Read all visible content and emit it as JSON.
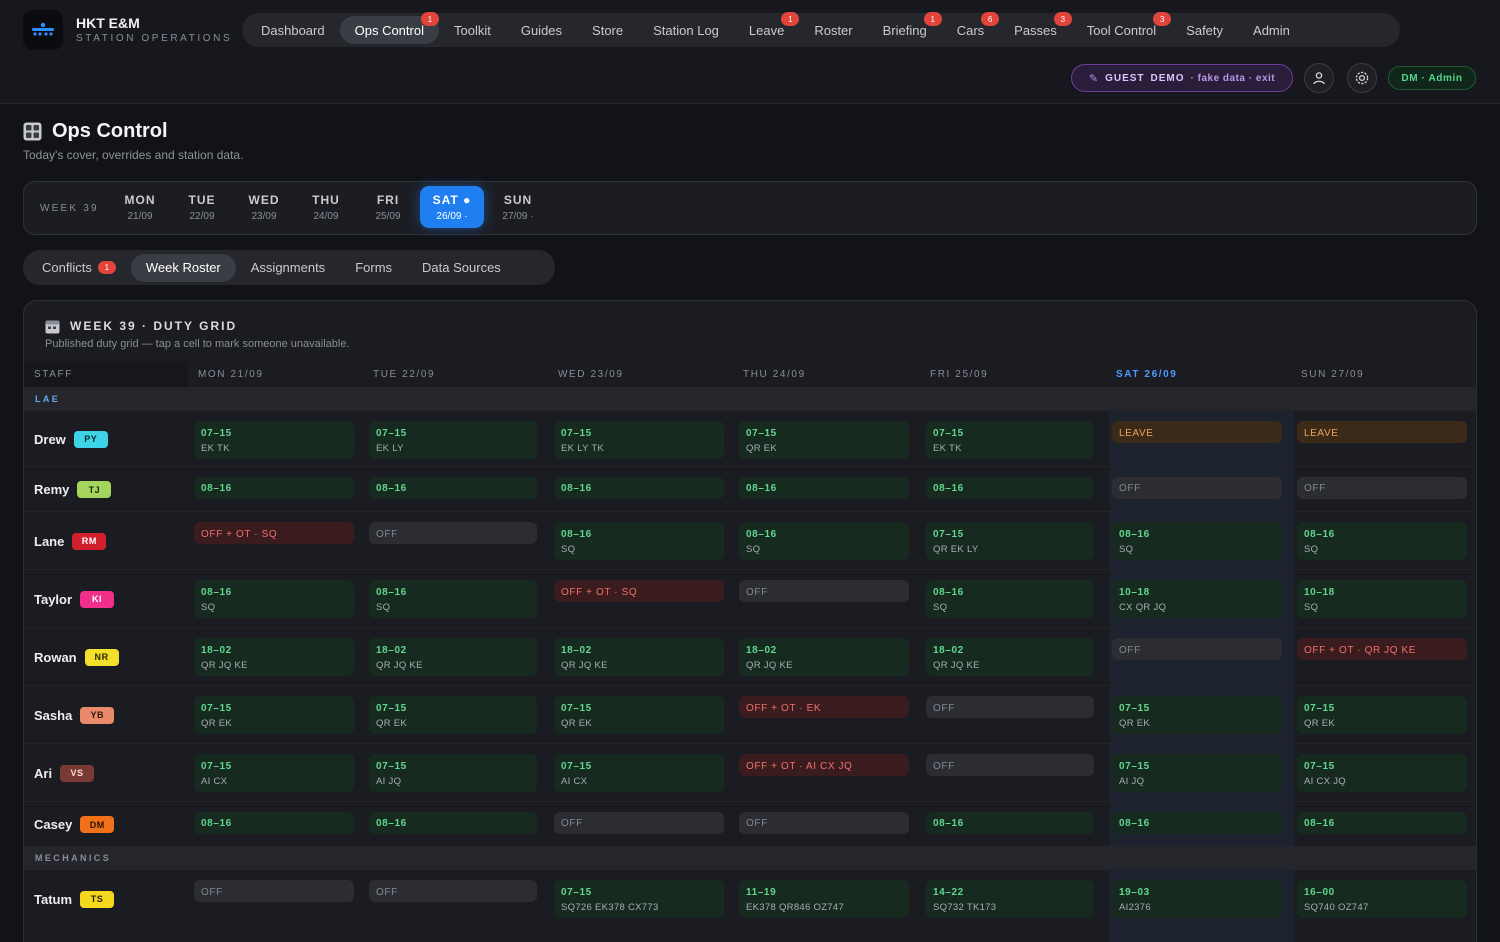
{
  "brand": {
    "name": "HKT E&M",
    "subtitle": "STATION OPERATIONS"
  },
  "nav": [
    {
      "label": "Dashboard",
      "badge": ""
    },
    {
      "label": "Ops Control",
      "badge": "1",
      "active": true
    },
    {
      "label": "Toolkit",
      "badge": ""
    },
    {
      "label": "Guides",
      "badge": ""
    },
    {
      "label": "Store",
      "badge": ""
    },
    {
      "label": "Station Log",
      "badge": ""
    },
    {
      "label": "Leave",
      "badge": "1"
    },
    {
      "label": "Roster",
      "badge": ""
    },
    {
      "label": "Briefing",
      "badge": "1"
    },
    {
      "label": "Cars",
      "badge": "6"
    },
    {
      "label": "Passes",
      "badge": "3"
    },
    {
      "label": "Tool Control",
      "badge": "3"
    },
    {
      "label": "Safety",
      "badge": ""
    },
    {
      "label": "Admin",
      "badge": ""
    }
  ],
  "guest": {
    "guest": "GUEST",
    "demo": "DEMO",
    "note": "· fake data · exit"
  },
  "user_pill": "DM · Admin",
  "icons": {
    "user": "user-icon",
    "settings": "gear-icon",
    "logo": "aircraft-logo-icon",
    "page": "control-panel-icon",
    "calendar": "calendar-icon",
    "pencil": "pencil-icon"
  },
  "page": {
    "title": "Ops Control",
    "subtitle": "Today's cover, overrides and station data."
  },
  "week": {
    "label": "WEEK 39",
    "days": [
      {
        "name": "MON",
        "date": "21/09"
      },
      {
        "name": "TUE",
        "date": "22/09"
      },
      {
        "name": "WED",
        "date": "23/09"
      },
      {
        "name": "THU",
        "date": "24/09"
      },
      {
        "name": "FRI",
        "date": "25/09"
      },
      {
        "name": "SAT ●",
        "date": "26/09 ·",
        "active": true
      },
      {
        "name": "SUN",
        "date": "27/09 ·"
      }
    ]
  },
  "subtabs": [
    {
      "label": "Conflicts",
      "badge": "1"
    },
    {
      "label": "Week Roster",
      "active": true
    },
    {
      "label": "Assignments"
    },
    {
      "label": "Forms"
    },
    {
      "label": "Data Sources"
    }
  ],
  "grid": {
    "title": "WEEK 39 · DUTY GRID",
    "subtitle": "Published duty grid — tap a cell to mark someone unavailable.",
    "staff_header": "STAFF",
    "day_headers": [
      "MON 21/09",
      "TUE 22/09",
      "WED 23/09",
      "THU 24/09",
      "FRI 25/09",
      "SAT 26/09",
      "SUN 27/09"
    ],
    "sections": [
      {
        "label": "LAE",
        "rows": [
          {
            "name": "Drew",
            "badge": "PY",
            "badge_bg": "#3fd3e8",
            "badge_fg": "#0b2a30",
            "cells": [
              [
                "work",
                "07–15",
                "EK TK"
              ],
              [
                "work",
                "07–15",
                "EK LY"
              ],
              [
                "work",
                "07–15",
                "EK LY TK"
              ],
              [
                "work",
                "07–15",
                "QR EK"
              ],
              [
                "work",
                "07–15",
                "EK TK"
              ],
              [
                "leave",
                "LEAVE",
                ""
              ],
              [
                "leave",
                "LEAVE",
                ""
              ]
            ]
          },
          {
            "name": "Remy",
            "badge": "TJ",
            "badge_bg": "#a4d65e",
            "badge_fg": "#1f2c0c",
            "cells": [
              [
                "work",
                "08–16",
                ""
              ],
              [
                "work",
                "08–16",
                ""
              ],
              [
                "work",
                "08–16",
                ""
              ],
              [
                "work",
                "08–16",
                ""
              ],
              [
                "work",
                "08–16",
                ""
              ],
              [
                "off",
                "OFF",
                ""
              ],
              [
                "off",
                "OFF",
                ""
              ]
            ]
          },
          {
            "name": "Lane",
            "badge": "RM",
            "badge_bg": "#d0202e",
            "badge_fg": "#ffffff",
            "cells": [
              [
                "ot",
                "OFF + OT · SQ",
                ""
              ],
              [
                "off",
                "OFF",
                ""
              ],
              [
                "work",
                "08–16",
                "SQ"
              ],
              [
                "work",
                "08–16",
                "SQ"
              ],
              [
                "work",
                "07–15",
                "QR EK LY"
              ],
              [
                "work",
                "08–16",
                "SQ"
              ],
              [
                "work",
                "08–16",
                "SQ"
              ]
            ]
          },
          {
            "name": "Taylor",
            "badge": "KI",
            "badge_bg": "#ef2f8a",
            "badge_fg": "#ffffff",
            "cells": [
              [
                "work",
                "08–16",
                "SQ"
              ],
              [
                "work",
                "08–16",
                "SQ"
              ],
              [
                "ot",
                "OFF + OT · SQ",
                ""
              ],
              [
                "off",
                "OFF",
                ""
              ],
              [
                "work",
                "08–16",
                "SQ"
              ],
              [
                "work",
                "10–18",
                "CX QR JQ"
              ],
              [
                "work",
                "10–18",
                "SQ"
              ]
            ]
          },
          {
            "name": "Rowan",
            "badge": "NR",
            "badge_bg": "#f2e02a",
            "badge_fg": "#2a2706",
            "cells": [
              [
                "work",
                "18–02",
                "QR JQ KE"
              ],
              [
                "work",
                "18–02",
                "QR JQ KE"
              ],
              [
                "work",
                "18–02",
                "QR JQ KE"
              ],
              [
                "work",
                "18–02",
                "QR JQ KE"
              ],
              [
                "work",
                "18–02",
                "QR JQ KE"
              ],
              [
                "off",
                "OFF",
                ""
              ],
              [
                "ot",
                "OFF + OT · QR JQ KE",
                ""
              ]
            ]
          },
          {
            "name": "Sasha",
            "badge": "YB",
            "badge_bg": "#e98a6a",
            "badge_fg": "#2f160d",
            "cells": [
              [
                "work",
                "07–15",
                "QR EK"
              ],
              [
                "work",
                "07–15",
                "QR EK"
              ],
              [
                "work",
                "07–15",
                "QR EK"
              ],
              [
                "ot",
                "OFF + OT · EK",
                ""
              ],
              [
                "off",
                "OFF",
                ""
              ],
              [
                "work",
                "07–15",
                "QR EK"
              ],
              [
                "work",
                "07–15",
                "QR EK"
              ]
            ]
          },
          {
            "name": "Ari",
            "badge": "VS",
            "badge_bg": "#7a3a34",
            "badge_fg": "#ffd9d2",
            "cells": [
              [
                "work",
                "07–15",
                "AI CX"
              ],
              [
                "work",
                "07–15",
                "AI JQ"
              ],
              [
                "work",
                "07–15",
                "AI CX"
              ],
              [
                "ot",
                "OFF + OT · AI CX JQ",
                ""
              ],
              [
                "off",
                "OFF",
                ""
              ],
              [
                "work",
                "07–15",
                "AI JQ"
              ],
              [
                "work",
                "07–15",
                "AI CX JQ"
              ]
            ]
          },
          {
            "name": "Casey",
            "badge": "DM",
            "badge_bg": "#f0711a",
            "badge_fg": "#2b1204",
            "cells": [
              [
                "work",
                "08–16",
                ""
              ],
              [
                "work",
                "08–16",
                ""
              ],
              [
                "off",
                "OFF",
                ""
              ],
              [
                "off",
                "OFF",
                ""
              ],
              [
                "work",
                "08–16",
                ""
              ],
              [
                "work",
                "08–16",
                ""
              ],
              [
                "work",
                "08–16",
                ""
              ]
            ]
          }
        ]
      },
      {
        "label": "MECHANICS",
        "rows": [
          {
            "name": "Tatum",
            "badge": "TS",
            "badge_bg": "#f5d81e",
            "badge_fg": "#2a2504",
            "cells": [
              [
                "off",
                "OFF",
                ""
              ],
              [
                "off",
                "OFF",
                ""
              ],
              [
                "work",
                "07–15",
                "SQ726 EK378 CX773"
              ],
              [
                "work",
                "11–19",
                "EK378 QR846 OZ747"
              ],
              [
                "work",
                "14–22",
                "SQ732 TK173"
              ],
              [
                "work",
                "19–03",
                "AI2376"
              ],
              [
                "work",
                "16–00",
                "SQ740 OZ747"
              ]
            ]
          }
        ]
      }
    ]
  }
}
